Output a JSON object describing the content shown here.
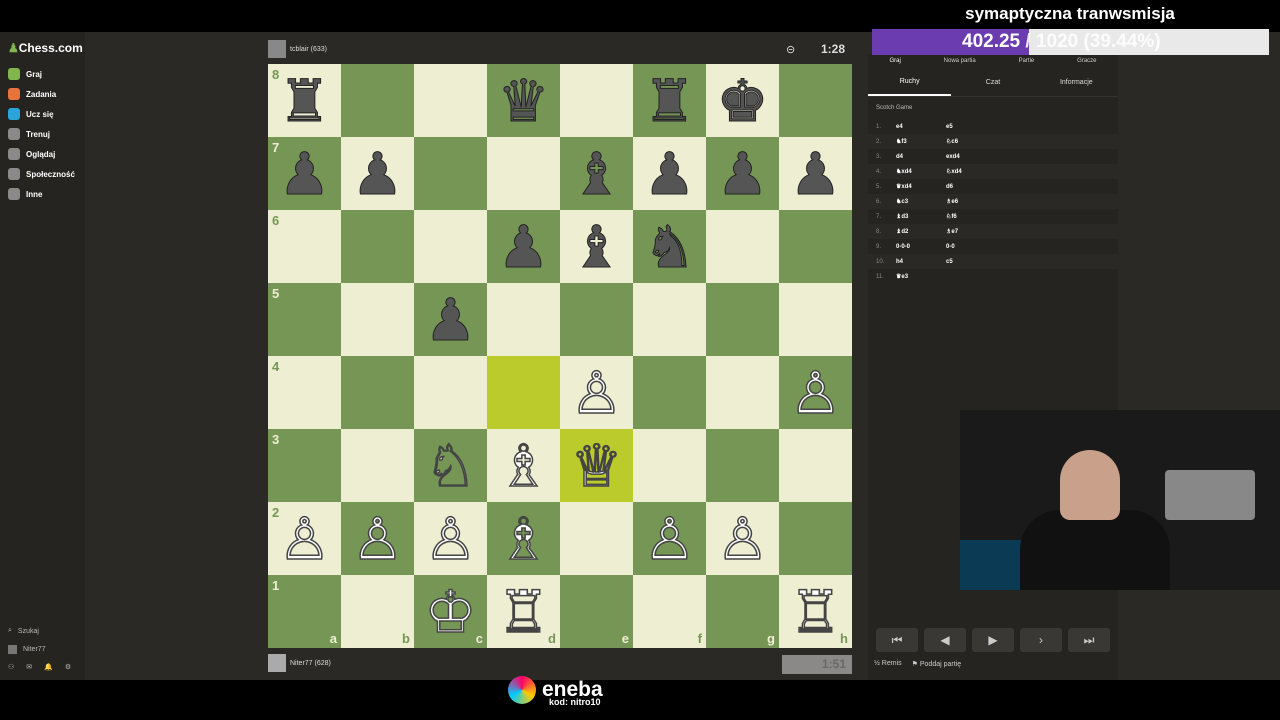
{
  "overlay": {
    "stream_title": "symaptyczna tranwsmisja",
    "goal_current": "402.25",
    "goal_rest": " / 1020 (39.44%)",
    "goal_fraction": 0.3944,
    "sponsor_name": "eneba",
    "sponsor_code": "kod: nitro10"
  },
  "sidebar": {
    "logo": "Chess.com",
    "items": [
      {
        "label": "Graj",
        "icon": "play-icon",
        "color": "#81b64c"
      },
      {
        "label": "Zadania",
        "icon": "puzzle-icon",
        "color": "#e8743b"
      },
      {
        "label": "Ucz się",
        "icon": "learn-icon",
        "color": "#2ba3db"
      },
      {
        "label": "Trenuj",
        "icon": "train-icon",
        "color": "#8a8a8a"
      },
      {
        "label": "Oglądaj",
        "icon": "watch-icon",
        "color": "#8a8a8a"
      },
      {
        "label": "Społeczność",
        "icon": "community-icon",
        "color": "#8a8a8a"
      },
      {
        "label": "Inne",
        "icon": "more-icon",
        "color": "#8a8a8a"
      }
    ],
    "search": "Szukaj",
    "user": "Niter77"
  },
  "game": {
    "top_player": "tcblair (633)",
    "top_clock": "1:28",
    "bottom_player": "Niter77 (628)",
    "bottom_clock": "1:51",
    "board": [
      [
        "bR",
        "",
        "",
        "bQ",
        "",
        "bR",
        "bK",
        ""
      ],
      [
        "bP",
        "bP",
        "",
        "",
        "bB",
        "bP",
        "bP",
        "bP"
      ],
      [
        "",
        "",
        "",
        "bP",
        "bB",
        "bN",
        "",
        ""
      ],
      [
        "",
        "",
        "bP",
        "",
        "",
        "",
        "",
        ""
      ],
      [
        "",
        "",
        "",
        "",
        "wP",
        "",
        "",
        "wP"
      ],
      [
        "",
        "",
        "wN",
        "wB",
        "wQ",
        "",
        "",
        ""
      ],
      [
        "wP",
        "wP",
        "wP",
        "wB",
        "",
        "wP",
        "wP",
        ""
      ],
      [
        "",
        "",
        "wK",
        "wR",
        "",
        "",
        "",
        "wR"
      ]
    ],
    "highlighted": [
      "d4",
      "e3"
    ],
    "ranks": [
      "8",
      "7",
      "6",
      "5",
      "4",
      "3",
      "2",
      "1"
    ],
    "files": [
      "a",
      "b",
      "c",
      "d",
      "e",
      "f",
      "g",
      "h"
    ]
  },
  "panel": {
    "tabs": [
      "Graj",
      "Nowa partia",
      "Partie",
      "Gracze"
    ],
    "subtabs": [
      "Ruchy",
      "Czat",
      "Informacje"
    ],
    "opening": "Scotch Game",
    "moves": [
      {
        "n": "1.",
        "w": "e4",
        "b": "e5"
      },
      {
        "n": "2.",
        "w": "♞f3",
        "b": "♘c6"
      },
      {
        "n": "3.",
        "w": "d4",
        "b": "exd4"
      },
      {
        "n": "4.",
        "w": "♞xd4",
        "b": "♘xd4"
      },
      {
        "n": "5.",
        "w": "♛xd4",
        "b": "d6"
      },
      {
        "n": "6.",
        "w": "♞c3",
        "b": "♗e6"
      },
      {
        "n": "7.",
        "w": "♝d3",
        "b": "♘f6"
      },
      {
        "n": "8.",
        "w": "♝d2",
        "b": "♗e7"
      },
      {
        "n": "9.",
        "w": "0-0-0",
        "b": "0-0"
      },
      {
        "n": "10.",
        "w": "h4",
        "b": "c5"
      },
      {
        "n": "11.",
        "w": "♛e3",
        "b": ""
      }
    ],
    "draw": "Remis",
    "resign": "Poddaj partię"
  }
}
